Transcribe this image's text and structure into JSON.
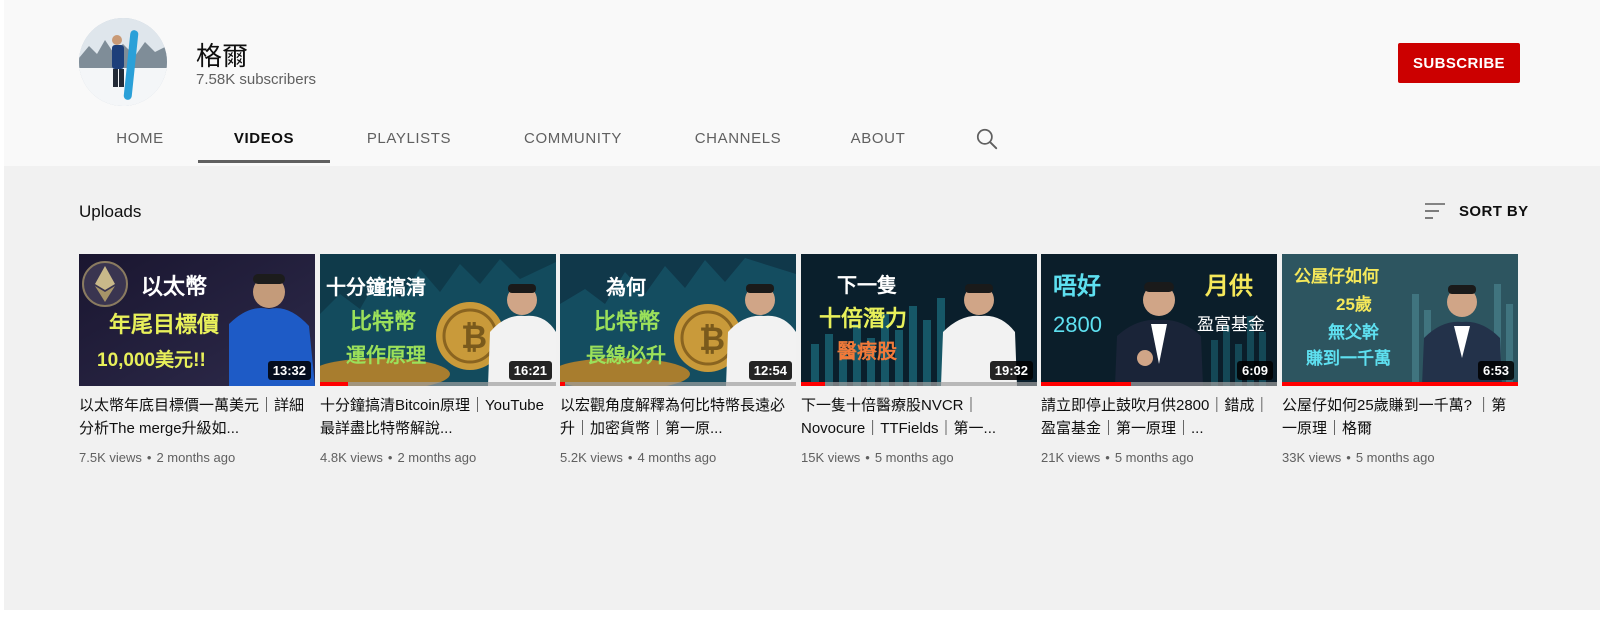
{
  "channel": {
    "name": "格爾",
    "subscribers": "7.58K subscribers",
    "subscribe_label": "SUBSCRIBE"
  },
  "tabs": [
    {
      "label": "HOME",
      "active": false
    },
    {
      "label": "VIDEOS",
      "active": true
    },
    {
      "label": "PLAYLISTS",
      "active": false
    },
    {
      "label": "COMMUNITY",
      "active": false
    },
    {
      "label": "CHANNELS",
      "active": false
    },
    {
      "label": "ABOUT",
      "active": false
    }
  ],
  "icons": {
    "tab_search": "search-icon",
    "sort": "sort-lines-icon"
  },
  "uploads": {
    "title": "Uploads",
    "sort_label": "SORT BY"
  },
  "colors": {
    "subscribe": "#cc0000",
    "progress": "#ff0000",
    "text_primary": "#0f0f0f",
    "text_secondary": "#606060"
  },
  "videos": [
    {
      "title": "以太幣年底目標價一萬美元｜詳細分析The merge升級如...",
      "views": "7.5K views",
      "age": "2 months ago",
      "duration": "13:32",
      "watched_fraction": 0,
      "thumb_lines": [
        "以太幣",
        "年尾目標價",
        "10,000美元!!"
      ]
    },
    {
      "title": "十分鐘搞清Bitcoin原理｜YouTube最詳盡比特幣解說...",
      "views": "4.8K views",
      "age": "2 months ago",
      "duration": "16:21",
      "watched_fraction": 0.12,
      "thumb_lines": [
        "十分鐘搞清",
        "比特幣",
        "運作原理"
      ]
    },
    {
      "title": "以宏觀角度解釋為何比特幣長遠必升｜加密貨幣｜第一原...",
      "views": "5.2K views",
      "age": "4 months ago",
      "duration": "12:54",
      "watched_fraction": 0.02,
      "thumb_lines": [
        "為何",
        "比特幣",
        "長線必升"
      ]
    },
    {
      "title": "下一隻十倍醫療股NVCR｜Novocure｜TTFields｜第一...",
      "views": "15K views",
      "age": "5 months ago",
      "duration": "19:32",
      "watched_fraction": 0.1,
      "thumb_lines": [
        "下一隻",
        "十倍潛力",
        "醫療股"
      ]
    },
    {
      "title": "請立即停止鼓吹月供2800｜錯成｜盈富基金｜第一原理｜...",
      "views": "21K views",
      "age": "5 months ago",
      "duration": "6:09",
      "watched_fraction": 0.38,
      "thumb_lines": [
        "唔好",
        "月供",
        "2800",
        "盈富基金"
      ]
    },
    {
      "title": "公屋仔如何25歲賺到一千萬? ｜第一原理｜格爾",
      "views": "33K views",
      "age": "5 months ago",
      "duration": "6:53",
      "watched_fraction": 1,
      "thumb_lines": [
        "公屋仔如何",
        "25歲",
        "無父幹",
        "賺到一千萬"
      ]
    }
  ]
}
